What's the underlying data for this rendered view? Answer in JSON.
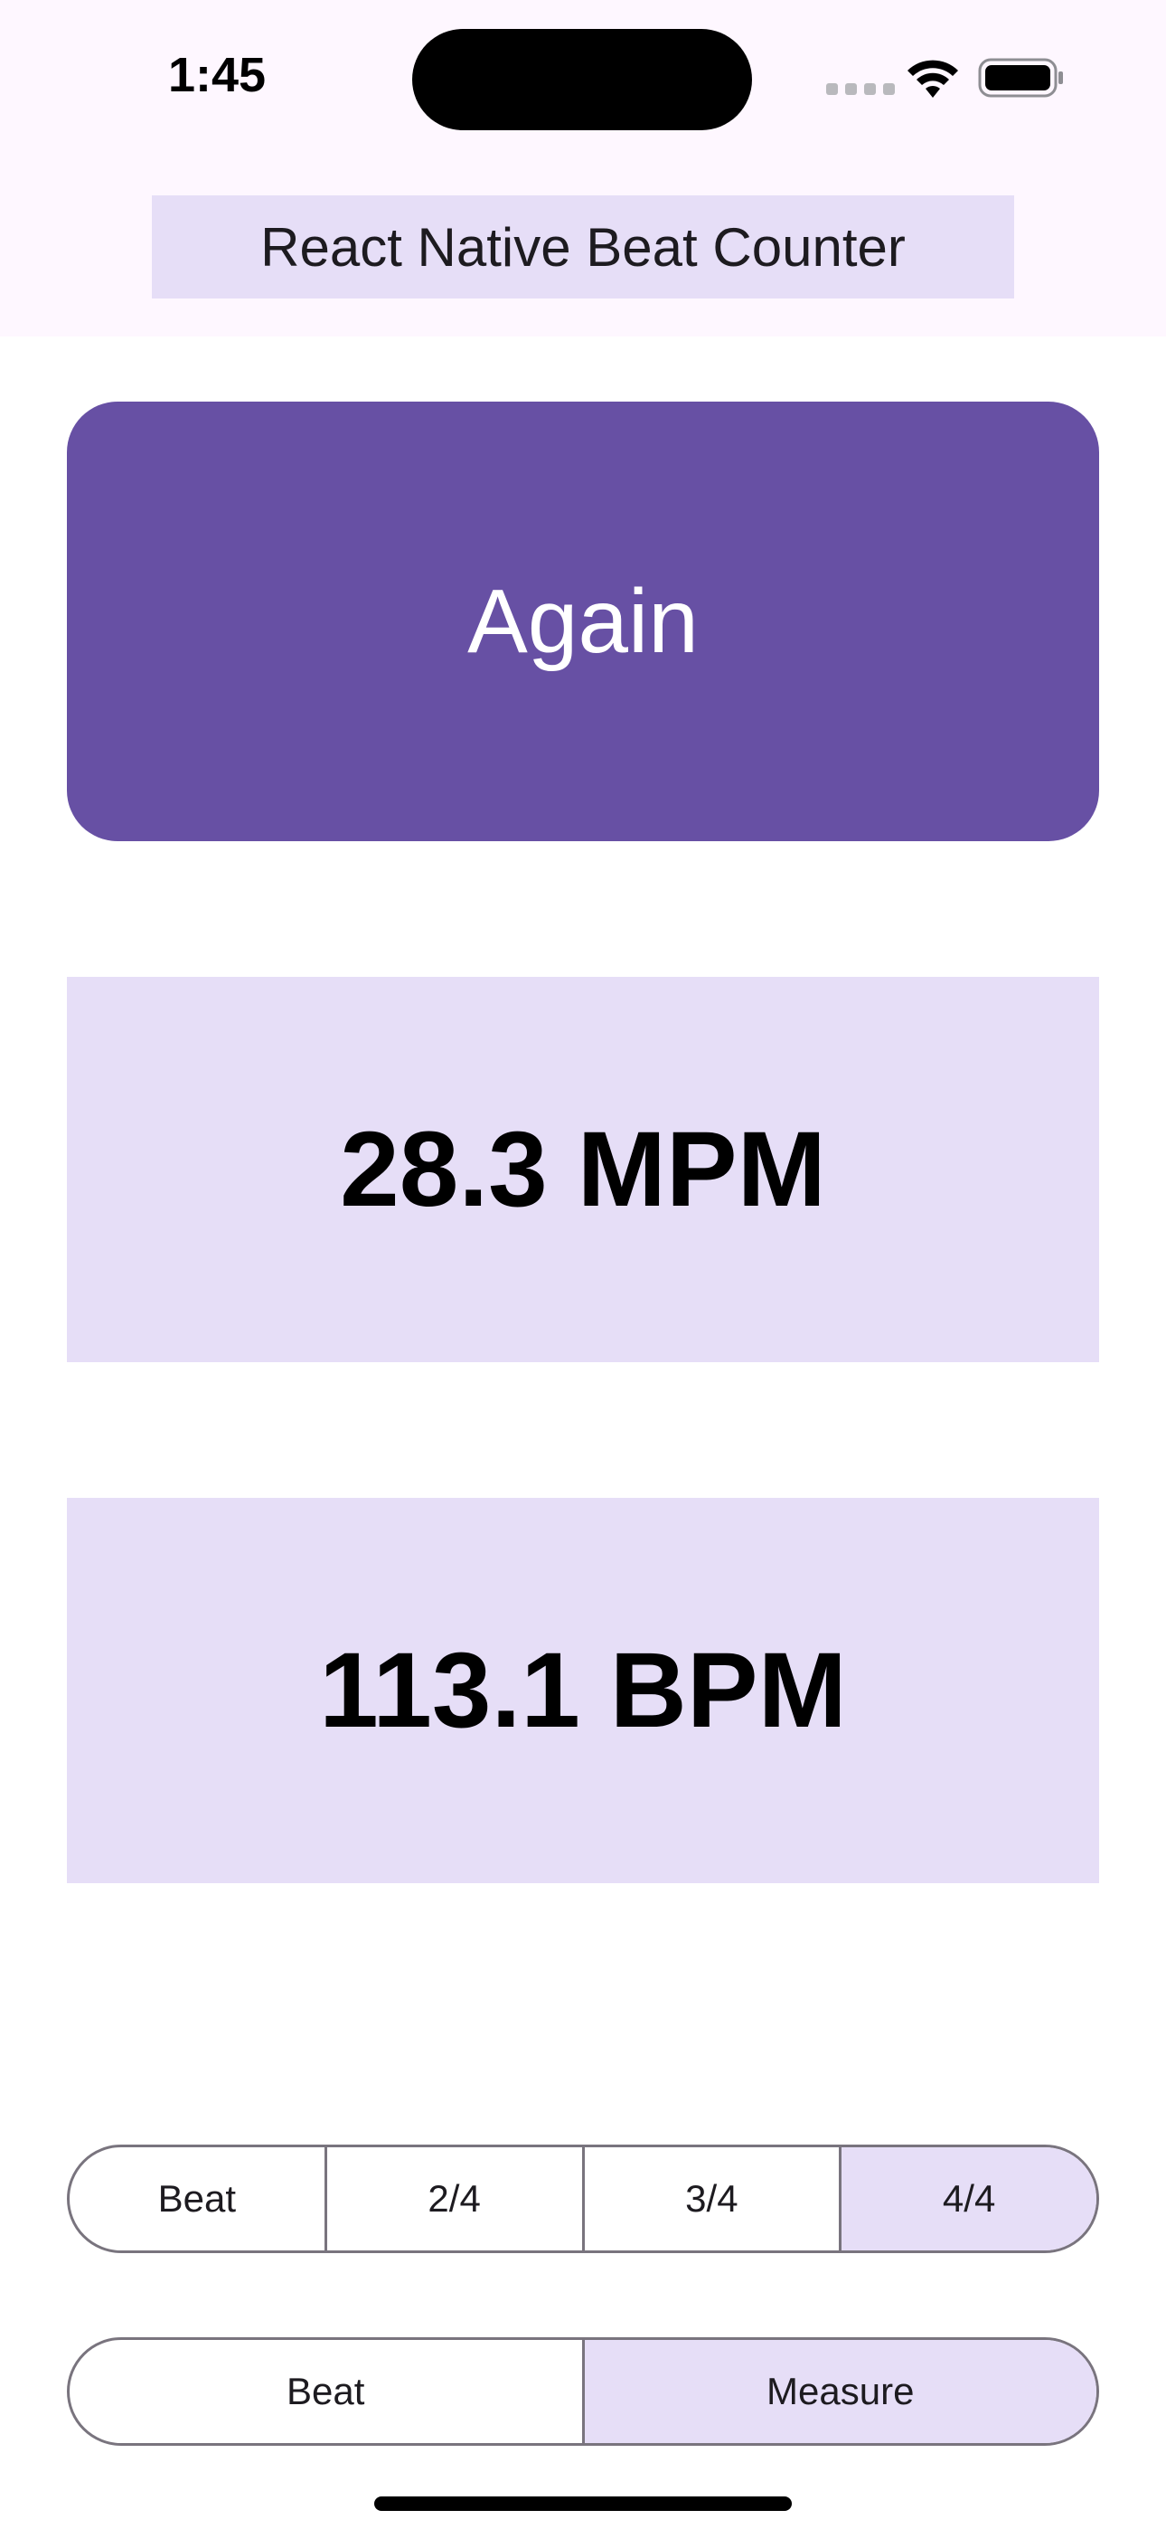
{
  "status_bar": {
    "time": "1:45",
    "icons": [
      "cellular-signal-icon",
      "wifi-icon",
      "battery-icon"
    ]
  },
  "header": {
    "title": "React Native Beat Counter"
  },
  "main": {
    "tap_button_label": "Again",
    "mpm_readout": "28.3 MPM",
    "bpm_readout": "113.1 BPM"
  },
  "time_signature": {
    "options": [
      "Beat",
      "2/4",
      "3/4",
      "4/4"
    ],
    "selected": "4/4"
  },
  "count_mode": {
    "options": [
      "Beat",
      "Measure"
    ],
    "selected": "Measure"
  },
  "colors": {
    "primary": "#6750a4",
    "primary_container": "#e6def7",
    "outline": "#79747e",
    "status_bar_bg": "#fef7ff"
  }
}
